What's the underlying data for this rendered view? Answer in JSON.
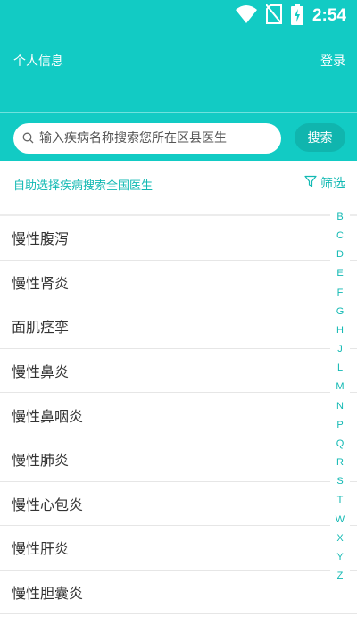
{
  "status_bar": {
    "time": "2:54",
    "icons": [
      "wifi-icon",
      "no-sim-icon",
      "battery-charging-icon"
    ]
  },
  "header": {
    "left_label": "个人信息",
    "right_label": "登录"
  },
  "search": {
    "placeholder": "输入疾病名称搜索您所在区县医生",
    "button_label": "搜索"
  },
  "filter": {
    "hint": "自助选择疾病搜索全国医生",
    "button_label": "筛选"
  },
  "diseases": [
    "慢性腹泻",
    "慢性肾炎",
    "面肌痉挛",
    "慢性鼻炎",
    "慢性鼻咽炎",
    "慢性肺炎",
    "慢性心包炎",
    "慢性肝炎",
    "慢性胆囊炎"
  ],
  "alphabet": [
    "B",
    "C",
    "D",
    "E",
    "F",
    "G",
    "H",
    "J",
    "L",
    "M",
    "N",
    "P",
    "Q",
    "R",
    "S",
    "T",
    "W",
    "X",
    "Y",
    "Z"
  ],
  "colors": {
    "brand": "#12cbc4",
    "accent_text": "#12b9b3",
    "search_button": "#10b5ae"
  }
}
